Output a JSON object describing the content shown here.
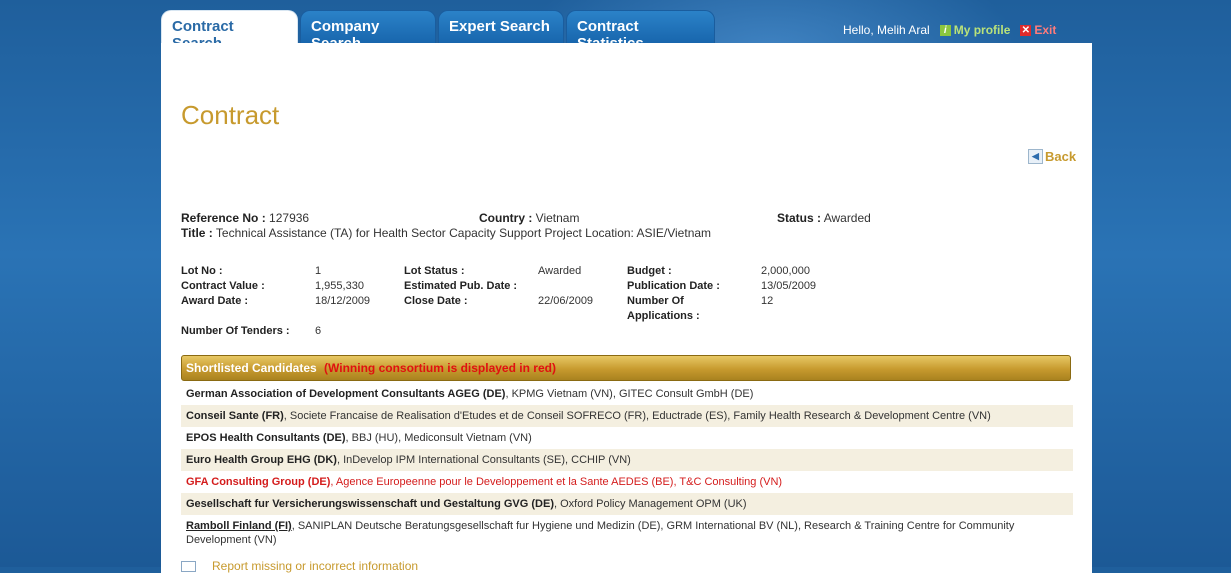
{
  "tabs": [
    "Contract Search",
    "Company Search",
    "Expert Search",
    "Contract Statistics"
  ],
  "user": {
    "greeting": "Hello, Melih Aral",
    "profile": "My profile",
    "exit": "Exit"
  },
  "page": {
    "title": "Contract",
    "back": "Back"
  },
  "contract": {
    "ref_label": "Reference No :",
    "ref_value": "127936",
    "country_label": "Country :",
    "country_value": "Vietnam",
    "status_label": "Status :",
    "status_value": "Awarded",
    "title_label": "Title :",
    "title_value": "Technical Assistance (TA) for Health Sector Capacity Support Project Location: ASIE/Vietnam"
  },
  "lot": {
    "lot_no_label": "Lot No :",
    "lot_no": "1",
    "contract_value_label": "Contract Value :",
    "contract_value": "1,955,330",
    "award_date_label": "Award Date :",
    "award_date": "18/12/2009",
    "tenders_label": "Number Of Tenders :",
    "tenders": "6",
    "lot_status_label": "Lot Status :",
    "lot_status": "Awarded",
    "est_pub_label": "Estimated Pub. Date :",
    "est_pub": "",
    "close_date_label": "Close Date :",
    "close_date": "22/06/2009",
    "budget_label": "Budget :",
    "budget": "2,000,000",
    "pub_date_label": "Publication Date :",
    "pub_date": "13/05/2009",
    "num_app_label_1": "Number Of",
    "num_app_label_2": "Applications :",
    "num_app": "12"
  },
  "candidates": {
    "header": "Shortlisted Candidates",
    "note": "(Winning consortium is displayed in red)",
    "items": [
      {
        "lead": "German Association of Development Consultants AGEG (DE)",
        "rest": ", KPMG Vietnam (VN), GITEC Consult GmbH (DE)"
      },
      {
        "lead": "Conseil Sante (FR)",
        "rest": ", Societe Francaise de Realisation d'Etudes et de Conseil SOFRECO (FR), Eductrade (ES), Family Health Research & Development Centre (VN)"
      },
      {
        "lead": "EPOS Health Consultants (DE)",
        "rest": ", BBJ (HU), Mediconsult Vietnam (VN)"
      },
      {
        "lead": "Euro Health Group EHG (DK)",
        "rest": ", InDevelop IPM International Consultants (SE), CCHIP (VN)"
      },
      {
        "lead": "GFA Consulting Group (DE)",
        "rest": ", Agence Europeenne pour le Developpement et la Sante AEDES (BE), T&C Consulting (VN)"
      },
      {
        "lead": "Gesellschaft fur Versicherungswissenschaft und Gestaltung GVG (DE)",
        "rest": ", Oxford Policy Management OPM (UK)"
      },
      {
        "lead": "Ramboll Finland (FI)",
        "rest": ", SANIPLAN Deutsche Beratungsgesellschaft fur Hygiene und Medizin (DE), GRM International BV (NL), Research & Training Centre for Community Development (VN)"
      }
    ]
  },
  "report": "Report missing or incorrect information",
  "colors": {
    "accent": "#c79a2e",
    "winner": "#d41c1c",
    "tab": "#1866ad"
  }
}
